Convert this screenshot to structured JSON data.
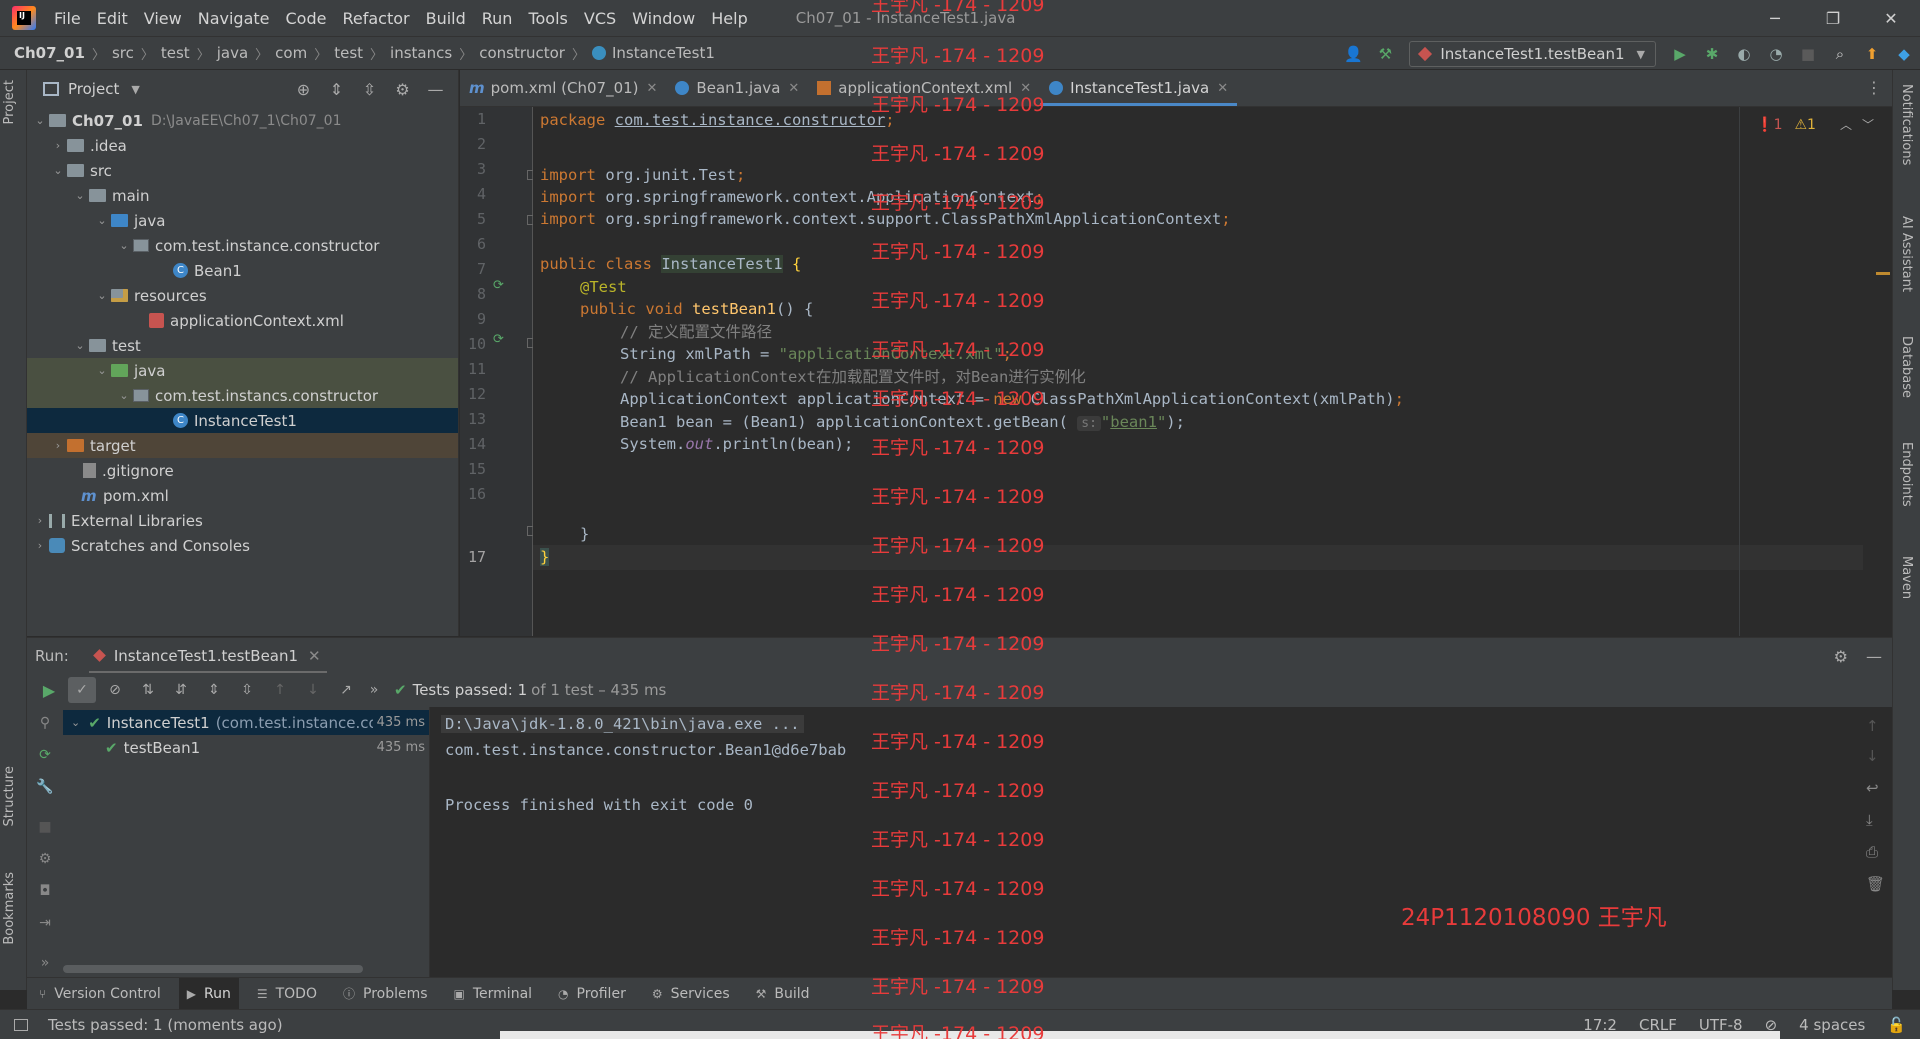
{
  "titlebar": {
    "menu": [
      "File",
      "Edit",
      "View",
      "Navigate",
      "Code",
      "Refactor",
      "Build",
      "Run",
      "Tools",
      "VCS",
      "Window",
      "Help"
    ],
    "window_title": "Ch07_01 - InstanceTest1.java",
    "controls": [
      "─",
      "❐",
      "✕"
    ]
  },
  "navbar": {
    "breadcrumb": [
      "Ch07_01",
      "src",
      "test",
      "java",
      "com",
      "test",
      "instancs",
      "constructor",
      "InstanceTest1"
    ],
    "run_config": "InstanceTest1.testBean1"
  },
  "project": {
    "title": "Project",
    "root": "Ch07_01",
    "root_path": "D:\\JavaEE\\Ch07_1\\Ch07_01",
    "idea": ".idea",
    "src": "src",
    "main": "main",
    "main_java": "java",
    "main_pkg": "com.test.instance.constructor",
    "bean1": "Bean1",
    "resources": "resources",
    "app_context": "applicationContext.xml",
    "test": "test",
    "test_java": "java",
    "test_pkg": "com.test.instancs.constructor",
    "instance_test": "InstanceTest1",
    "target": "target",
    "gitignore": ".gitignore",
    "pom": "pom.xml",
    "ext_libs": "External Libraries",
    "scratches": "Scratches and Consoles"
  },
  "editor": {
    "tabs": [
      {
        "label": "pom.xml (Ch07_01)"
      },
      {
        "label": "Bean1.java"
      },
      {
        "label": "applicationContext.xml"
      },
      {
        "label": "InstanceTest1.java"
      }
    ],
    "line_numbers": [
      "1",
      "2",
      "3",
      "4",
      "5",
      "6",
      "7",
      "8",
      "9",
      "10",
      "11",
      "12",
      "13",
      "14",
      "15",
      "16",
      "17"
    ],
    "code": {
      "l1_kw": "package ",
      "l1_pkg": "com.test.instance.constructor",
      "l1_end": ";",
      "l3_kw": "import ",
      "l3_rest": "org.junit.Test",
      "l4_kw": "import ",
      "l4_rest": "org.springframework.context.ApplicationContext",
      "l5_kw": "import ",
      "l5_rest": "org.springframework.context.support.ClassPathXmlApplicationContext",
      "semi": ";",
      "l7_kw": "public class ",
      "l7_cls": "InstanceTest1",
      "l7_brace": " {",
      "l8_ann": "@Test",
      "l9_kw": "public void ",
      "l9_fn": "testBean1",
      "l9_rest": "() {",
      "l10_cmt": "// 定义配置文件路径",
      "l11_a": "String xmlPath = ",
      "l11_str": "\"applicationContext.xml\"",
      "l12_cmt": "// ApplicationContext在加载配置文件时，对Bean进行实例化",
      "l13_a": "ApplicationContext applicationContext = ",
      "l13_kw": "new ",
      "l13_b": "ClassPathXmlApplicationContext(xmlPath)",
      "l14_a": "Bean1 bean = (Bean1) applicationContext.getBean( ",
      "l14_hint": "s:",
      "l14_str_q1": "\"",
      "l14_str": "bean1",
      "l14_str_q2": "\"",
      "l14_end": ");",
      "l15_a": "System.",
      "l15_out": "out",
      "l15_b": ".println(bean);",
      "l16": "}",
      "l17": "}"
    },
    "inspections": {
      "errors": "1",
      "warnings": "1"
    }
  },
  "run": {
    "label": "Run:",
    "tab": "InstanceTest1.testBean1",
    "tests_passed": "Tests passed: 1",
    "tests_rest": "of 1 test – 435 ms",
    "tree": [
      {
        "name": "InstanceTest1",
        "hint": "(com.test.instance.co",
        "duration": "435 ms"
      },
      {
        "name": "testBean1",
        "duration": "435 ms"
      }
    ],
    "console": [
      "D:\\Java\\jdk-1.8.0_421\\bin\\java.exe ...",
      "com.test.instance.constructor.Bean1@d6e7bab",
      "",
      "Process finished with exit code 0"
    ]
  },
  "bottom_tools": [
    "Version Control",
    "Run",
    "TODO",
    "Problems",
    "Terminal",
    "Profiler",
    "Services",
    "Build"
  ],
  "left_strip": {
    "project": "Project",
    "structure": "Structure",
    "bookmarks": "Bookmarks"
  },
  "right_strip": {
    "notifications": "Notifications",
    "ai": "AI Assistant",
    "database": "Database",
    "endpoints": "Endpoints",
    "maven": "Maven"
  },
  "status": {
    "message": "Tests passed: 1 (moments ago)",
    "position": "17:2",
    "line_sep": "CRLF",
    "encoding": "UTF-8",
    "indent": "4 spaces"
  },
  "watermark": {
    "repeat": "王宇凡 -174 - 1209",
    "stamp": "24P1120108090 王宇凡"
  },
  "colors": {
    "keyword": "#cc7832",
    "string": "#6a8759",
    "comment": "#808080",
    "annotation": "#bbb529",
    "success": "#59a869",
    "watermark": "#e83b3b"
  }
}
